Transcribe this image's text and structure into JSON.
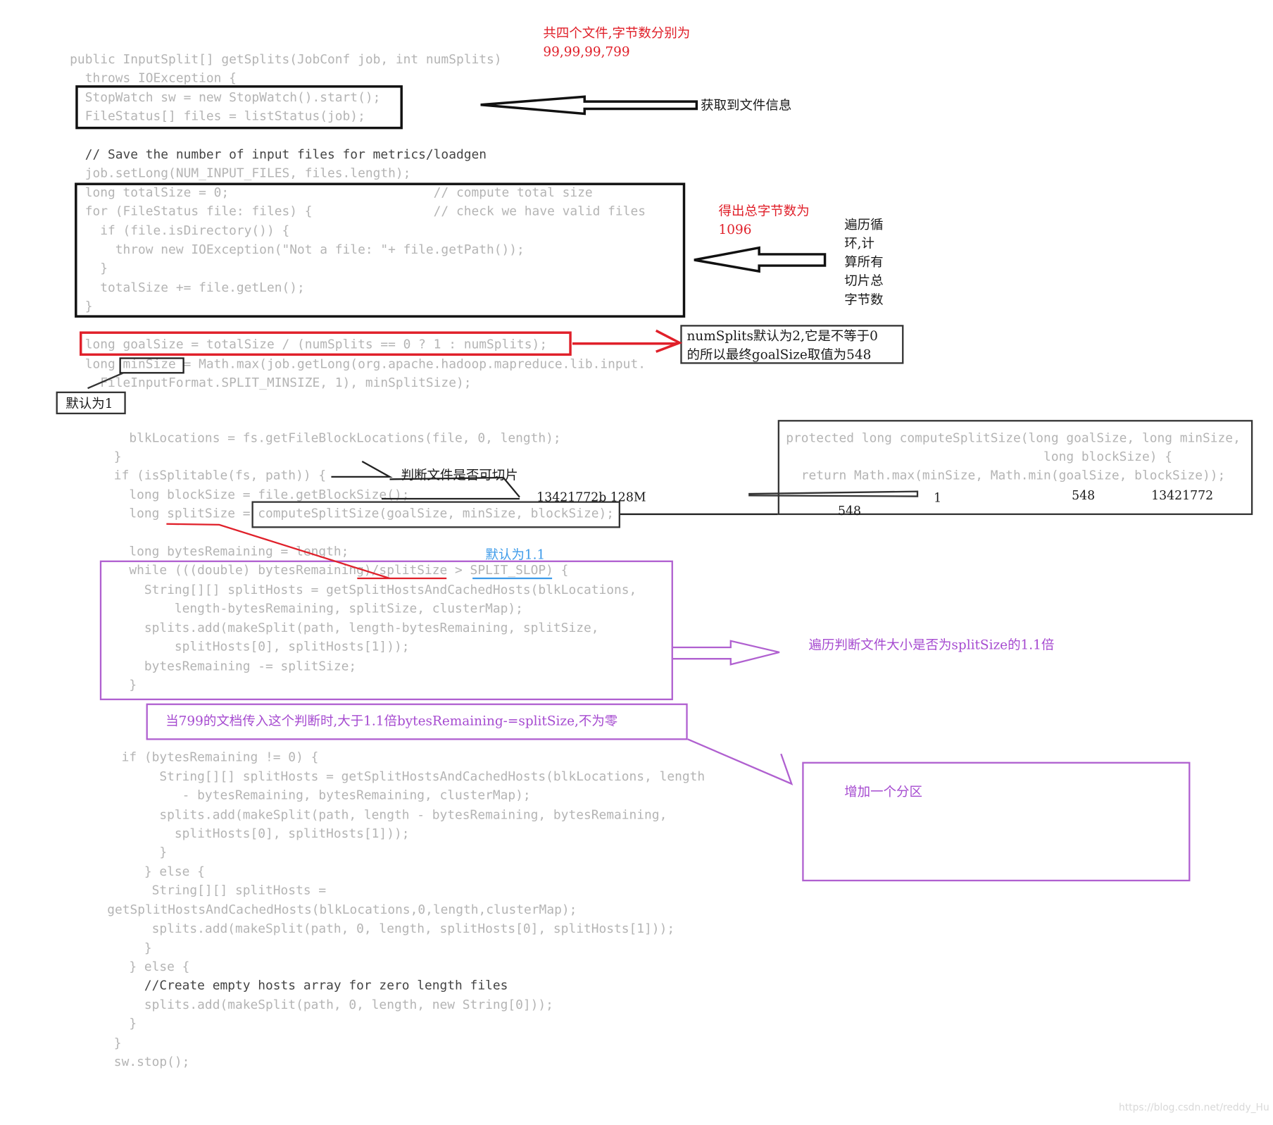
{
  "code": {
    "l01": "public InputSplit[] getSplits(JobConf job, int numSplits)",
    "l02": "  throws IOException {",
    "l03": "  StopWatch sw = new StopWatch().start();",
    "l04": "  FileStatus[] files = listStatus(job);",
    "l05": "  // Save the number of input files for metrics/loadgen",
    "l06": "  job.setLong(NUM_INPUT_FILES, files.length);",
    "l07": "  long totalSize = 0;                           // compute total size",
    "l08": "  for (FileStatus file: files) {                // check we have valid files",
    "l09": "    if (file.isDirectory()) {",
    "l10": "      throw new IOException(\"Not a file: \"+ file.getPath());",
    "l11": "    }",
    "l12": "    totalSize += file.getLen();",
    "l13": "  }",
    "l14": "  long goalSize = totalSize / (numSplits == 0 ? 1 : numSplits);",
    "l15": "  long minSize = Math.max(job.getLong(org.apache.hadoop.mapreduce.lib.input.",
    "l16": "    FileInputFormat.SPLIT_MINSIZE, 1), minSplitSize);",
    "l17": "      blkLocations = fs.getFileBlockLocations(file, 0, length);",
    "l18": "    }",
    "l19": "    if (isSplitable(fs, path)) {",
    "l20": "      long blockSize = file.getBlockSize();",
    "l21": "      long splitSize = computeSplitSize(goalSize, minSize, blockSize);",
    "l22": "      long bytesRemaining = length;",
    "l23": "      while (((double) bytesRemaining)/splitSize > SPLIT_SLOP) {",
    "l24": "        String[][] splitHosts = getSplitHostsAndCachedHosts(blkLocations,",
    "l25": "            length-bytesRemaining, splitSize, clusterMap);",
    "l26": "        splits.add(makeSplit(path, length-bytesRemaining, splitSize,",
    "l27": "            splitHosts[0], splitHosts[1]));",
    "l28": "        bytesRemaining -= splitSize;",
    "l29": "      }",
    "l30": "     if (bytesRemaining != 0) {",
    "l31": "          String[][] splitHosts = getSplitHostsAndCachedHosts(blkLocations, length",
    "l32": "             - bytesRemaining, bytesRemaining, clusterMap);",
    "l33": "          splits.add(makeSplit(path, length - bytesRemaining, bytesRemaining,",
    "l34": "            splitHosts[0], splitHosts[1]));",
    "l35": "          }",
    "l36": "        } else {",
    "l37": "         String[][] splitHosts =",
    "l38": "getSplitHostsAndCachedHosts(blkLocations,0,length,clusterMap);",
    "l39": "         splits.add(makeSplit(path, 0, length, splitHosts[0], splitHosts[1]));",
    "l40": "        }",
    "l41": "      } else {",
    "l42": "        //Create empty hosts array for zero length files",
    "l43": "        splits.add(makeSplit(path, 0, length, new String[0]));",
    "l44": "      }",
    "l45": "    }",
    "l46": "    sw.stop();"
  },
  "side_code": {
    "s1": "protected long computeSplitSize(long goalSize, long minSize,",
    "s2": "                                  long blockSize) {",
    "s3": "  return Math.max(minSize, Math.min(goalSize, blockSize));"
  },
  "annotations": {
    "files_info": "共四个文件,字节数分别为\n99,99,99,799",
    "get_file_info": "获取到文件信息",
    "total_bytes": "得出总字节数为\n1096",
    "loop_sum": "遍历循\n环,计\n算所有\n切片总\n字节数",
    "numsplits_note": "numSplits默认为2,它是不等于0\n的所以最终goalSize取值为548",
    "default_one": "默认为1",
    "is_splitable": "判断文件是否可切片",
    "block_size_value": "13421772b 128M",
    "default_1_1": "默认为1.1",
    "val_1": "1",
    "val_548_a": "548",
    "val_13421772": "13421772",
    "val_548_b": "548",
    "loop_check": "遍历判断文件大小是否为splitSize的1.1倍",
    "when_799": "当799的文档传入这个判断时,大于1.1倍bytesRemaining-=splitSize,不为零",
    "add_partition": "增加一个分区"
  },
  "watermark": "https://blog.csdn.net/reddy_Hu",
  "colors": {
    "red": "#e0202a",
    "purple": "#a64bd0",
    "black": "#1a1a1a",
    "blue": "#3d9be9",
    "code_gray": "#b4b4b4"
  }
}
